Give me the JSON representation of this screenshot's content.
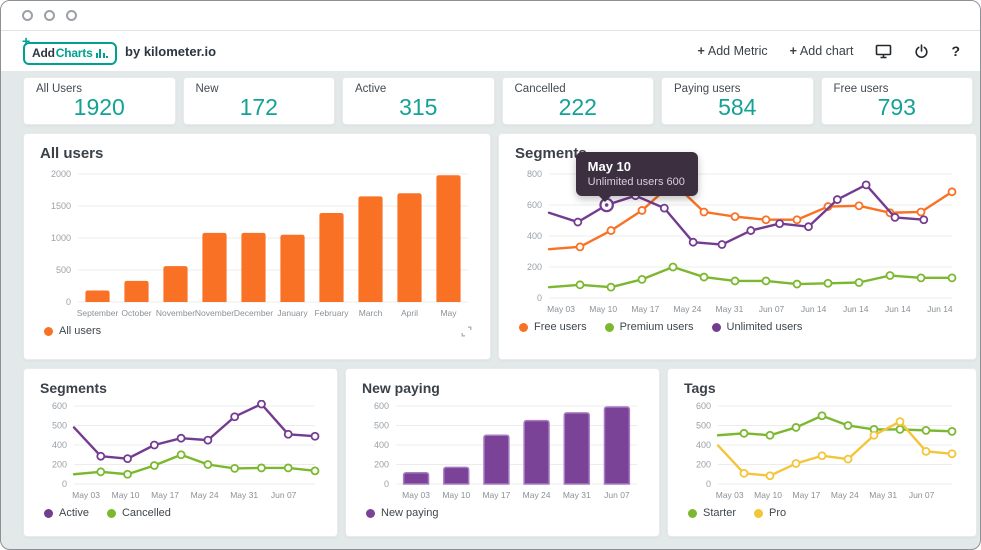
{
  "header": {
    "logo": {
      "plus": "+",
      "add": "Add",
      "charts": "Charts",
      "by": "by kilometer.io"
    },
    "actions": {
      "add_metric_plus": "+",
      "add_metric": "Add Metric",
      "add_chart_plus": "+",
      "add_chart": "Add chart",
      "help": "?"
    },
    "icons": [
      "monitor-icon",
      "power-icon"
    ]
  },
  "colors": {
    "teal": "#00a18f",
    "orange": "#f97124",
    "green": "#7cb82f",
    "purple": "#743c91",
    "yellow": "#f3c53b",
    "stat_value": "#14a294"
  },
  "stats": [
    {
      "label": "All Users",
      "value": "1920"
    },
    {
      "label": "New",
      "value": "172"
    },
    {
      "label": "Active",
      "value": "315"
    },
    {
      "label": "Cancelled",
      "value": "222"
    },
    {
      "label": "Paying users",
      "value": "584"
    },
    {
      "label": "Free users",
      "value": "793"
    }
  ],
  "charts": {
    "all_users": {
      "title": "All users",
      "type": "bar",
      "color": "#f97124",
      "margin_left": 38,
      "yticks": [
        2000,
        1500,
        1000,
        500,
        0
      ],
      "categories": [
        "September",
        "October",
        "November",
        "November",
        "December",
        "January",
        "February",
        "March",
        "April",
        "May"
      ],
      "values": [
        180,
        330,
        560,
        1080,
        1080,
        1050,
        1390,
        1650,
        1700,
        1980
      ],
      "legend": [
        {
          "label": "All users",
          "color": "#f97124"
        }
      ]
    },
    "segments_top": {
      "title": "Segments",
      "type": "line",
      "yticks": [
        800,
        600,
        400,
        200,
        0
      ],
      "x_labels": [
        "May 03",
        "May 10",
        "May 17",
        "May 24",
        "May 31",
        "Jun 07",
        "Jun 14",
        "Jun 14",
        "Jun 14",
        "Jun 14"
      ],
      "label_start": 0.03,
      "label_end": 0.97,
      "series": [
        {
          "name": "Free users",
          "color": "#f97124",
          "values": [
            315,
            330,
            435,
            565,
            745,
            555,
            525,
            505,
            505,
            590,
            595,
            550,
            555,
            685
          ]
        },
        {
          "name": "Premium users",
          "color": "#7cb82f",
          "values": [
            70,
            85,
            70,
            120,
            200,
            135,
            110,
            110,
            90,
            95,
            100,
            145,
            130,
            130
          ]
        },
        {
          "name": "Unlimited users",
          "color": "#743c91",
          "span": 0.93,
          "values": [
            550,
            490,
            600,
            660,
            580,
            360,
            345,
            435,
            480,
            460,
            635,
            730,
            520,
            505
          ]
        }
      ],
      "highlight": {
        "series": 2,
        "index": 2,
        "title": "May 10",
        "text": "Unlimited users 600"
      }
    },
    "segments_bottom": {
      "title": "Segments",
      "type": "line",
      "yticks": [
        600,
        500,
        400,
        200,
        0
      ],
      "x_labels": [
        "May 03",
        "May 10",
        "May 17",
        "May 24",
        "May 31",
        "Jun 07"
      ],
      "label_start": 0.05,
      "label_end": 0.87,
      "series": [
        {
          "name": "Active",
          "color": "#743c91",
          "values": [
            490,
            285,
            260,
            400,
            435,
            425,
            545,
            610,
            455,
            445
          ]
        },
        {
          "name": "Cancelled",
          "color": "#7cb82f",
          "values": [
            100,
            125,
            100,
            190,
            300,
            200,
            160,
            165,
            165,
            135
          ]
        }
      ]
    },
    "new_paying": {
      "title": "New paying",
      "type": "bar",
      "color": "#7b4397",
      "bar_border": "#a87cc4",
      "yticks": [
        600,
        500,
        400,
        200,
        0
      ],
      "categories": [
        "May 03",
        "May 10",
        "May 17",
        "May 24",
        "May 31",
        "Jun 07"
      ],
      "values": [
        115,
        170,
        450,
        525,
        565,
        595
      ],
      "legend": [
        {
          "label": "New paying",
          "color": "#7b4397"
        }
      ]
    },
    "tags": {
      "title": "Tags",
      "type": "line",
      "yticks": [
        600,
        500,
        400,
        200,
        0
      ],
      "x_labels": [
        "May 03",
        "May 10",
        "May 17",
        "May 24",
        "May 31",
        "Jun 07"
      ],
      "label_start": 0.05,
      "label_end": 0.87,
      "series": [
        {
          "name": "Starter",
          "color": "#7cb82f",
          "values": [
            450,
            460,
            450,
            490,
            550,
            500,
            480,
            480,
            475,
            470
          ]
        },
        {
          "name": "Pro",
          "color": "#f3c53b",
          "values": [
            395,
            110,
            85,
            210,
            290,
            255,
            450,
            520,
            335,
            310
          ]
        }
      ]
    }
  }
}
